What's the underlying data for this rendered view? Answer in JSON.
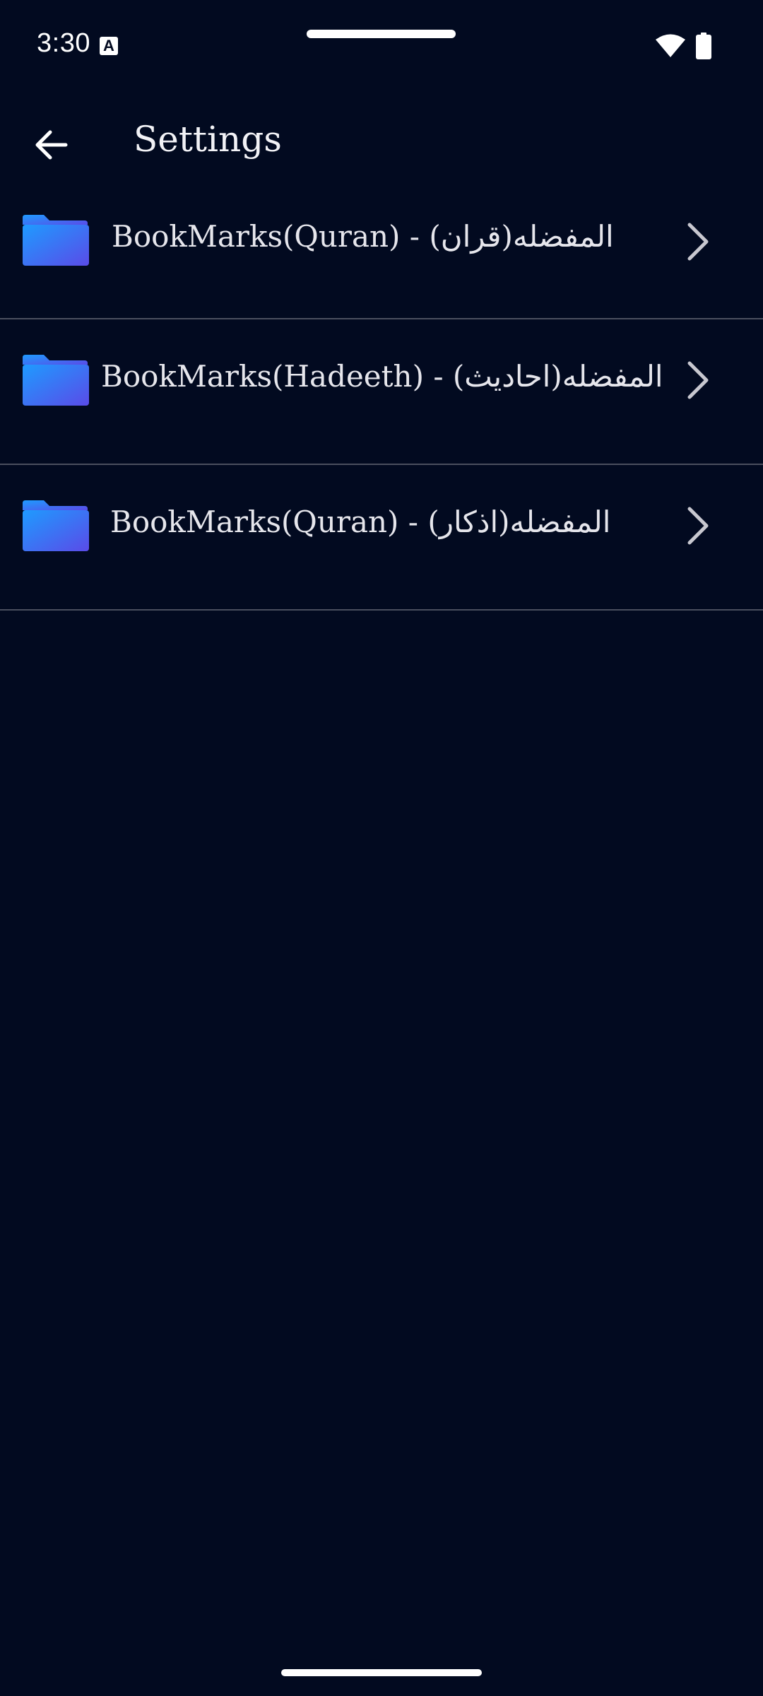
{
  "status_bar": {
    "time": "3:30",
    "notification_icon_letter": "A",
    "icons": [
      "a-notification-icon",
      "wifi-icon",
      "battery-icon"
    ]
  },
  "app_bar": {
    "back_icon": "arrow-left-icon",
    "title": "Settings"
  },
  "list": {
    "items": [
      {
        "icon": "folder-icon",
        "label": "BookMarks(Quran) - (المفضله(قران",
        "trailing_icon": "chevron-right-icon"
      },
      {
        "icon": "folder-icon",
        "label": "BookMarks(Hadeeth) - (المفضله(احادیث",
        "trailing_icon": "chevron-right-icon"
      },
      {
        "icon": "folder-icon",
        "label": "BookMarks(Quran) - (المفضله(اذكار",
        "trailing_icon": "chevron-right-icon"
      }
    ]
  },
  "colors": {
    "background": "#020A20",
    "folder_gradient_start": "#1E9BFF",
    "folder_gradient_end": "#5A4BE8",
    "divider": "#4A4F5E",
    "text": "#E6E6EC"
  }
}
